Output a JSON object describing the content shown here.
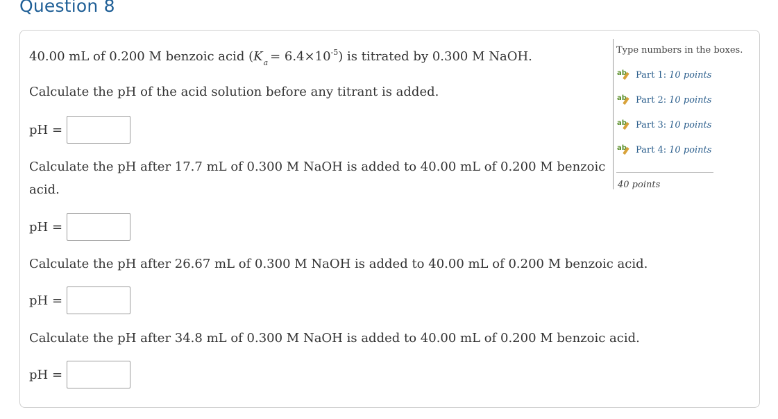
{
  "question_title": "Question 8",
  "intro": {
    "before": "40.00 mL of 0.200 M benzoic acid (",
    "K": "K",
    "K_sub": "a",
    "middle": "= 6.4×10",
    "exp": "-5",
    "after": ") is titrated by 0.300 M NaOH."
  },
  "parts": [
    {
      "prompt": "Calculate the pH of the acid solution before any titrant is added.",
      "label": "pH =",
      "value": ""
    },
    {
      "prompt_line1": "Calculate the pH after 17.7 mL of 0.300 M NaOH is added to 40.00 mL of 0.200 M benzoic",
      "prompt_line2": "acid.",
      "label": "pH =",
      "value": ""
    },
    {
      "prompt": "Calculate the pH after 26.67 mL of 0.300 M NaOH is added to 40.00 mL of 0.200 M benzoic acid.",
      "label": "pH =",
      "value": ""
    },
    {
      "prompt": "Calculate the pH after 34.8 mL of 0.300 M NaOH is added to 40.00 mL of 0.200 M benzoic acid.",
      "label": "pH =",
      "value": ""
    }
  ],
  "sidebar": {
    "instructions": "Type numbers in the boxes.",
    "icon": "ab-pencil-icon",
    "icon_text": "ab",
    "items": [
      {
        "part": "Part 1:",
        "points": "10 points"
      },
      {
        "part": "Part 2:",
        "points": "10 points"
      },
      {
        "part": "Part 3:",
        "points": "10 points"
      },
      {
        "part": "Part 4:",
        "points": "10 points"
      }
    ],
    "total": "40 points"
  },
  "colors": {
    "title": "#1f5f96",
    "link": "#2c5f8d",
    "icon_green": "#5a8f2a",
    "icon_pencil": "#d8a23a"
  }
}
